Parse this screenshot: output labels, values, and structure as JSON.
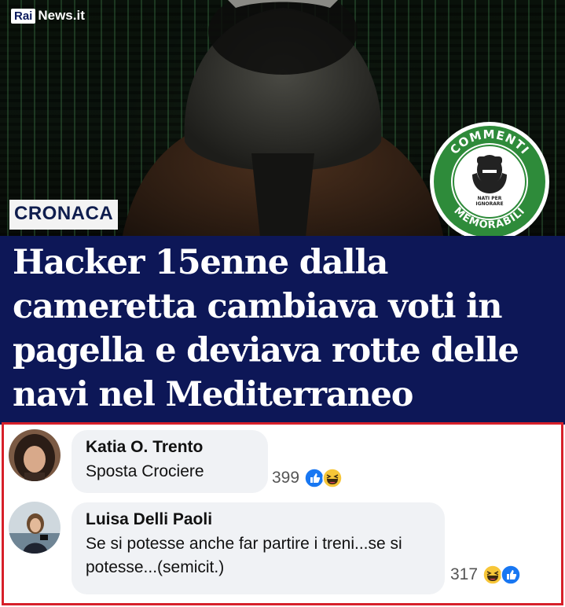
{
  "brand": {
    "rai": "Rai",
    "news": "News.it"
  },
  "category_tag": "CRONACA",
  "badge": {
    "top_text": "COMMENTI",
    "bottom_text": "MEMORABILI",
    "inner_text_1": "NATI PER",
    "inner_text_2": "IGNORARE"
  },
  "headline": "Hacker 15enne dalla cameretta cambiava voti in pagella e deviava rotte delle navi nel Mediterraneo",
  "comments": [
    {
      "author": "Katia O. Trento",
      "text": "Sposta Crociere",
      "reactions_count": "399",
      "reactions": [
        "like-icon",
        "haha-icon"
      ]
    },
    {
      "author": "Luisa Delli Paoli",
      "text": "Se si potesse anche far partire i treni...se si potesse...(semicit.)",
      "reactions_count": "317",
      "reactions": [
        "haha-icon",
        "like-icon"
      ]
    }
  ],
  "colors": {
    "headline_bg": "#0d1757",
    "frame": "#d7202a",
    "badge_green": "#2e8b3a",
    "bubble": "#f0f2f5"
  }
}
